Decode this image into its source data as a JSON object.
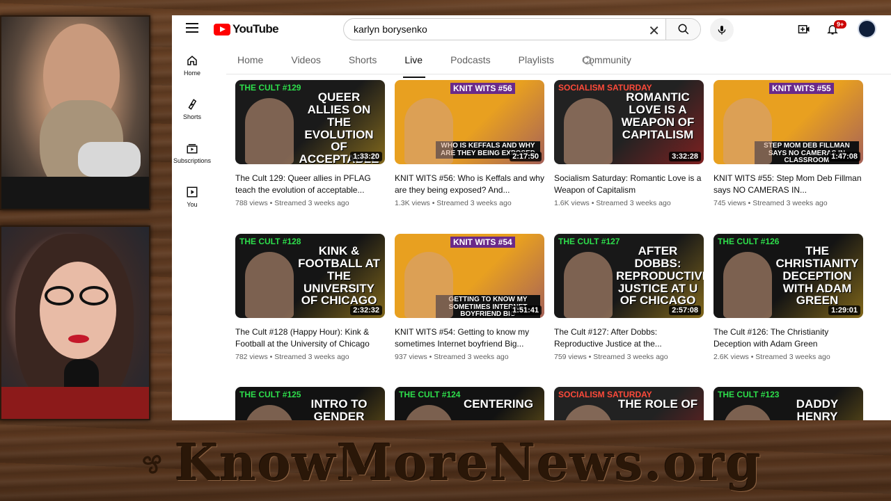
{
  "overlay": {
    "watermark": "KnowMoreNews.org"
  },
  "header": {
    "logo_text": "YouTube",
    "search_value": "karlyn borysenko",
    "notifications_badge": "9+"
  },
  "sidebar": {
    "items": [
      {
        "label": "Home",
        "icon": "home-icon"
      },
      {
        "label": "Shorts",
        "icon": "shorts-icon"
      },
      {
        "label": "Subscriptions",
        "icon": "subscriptions-icon"
      },
      {
        "label": "You",
        "icon": "you-icon"
      }
    ]
  },
  "tabs": [
    {
      "label": "Home"
    },
    {
      "label": "Videos"
    },
    {
      "label": "Shorts"
    },
    {
      "label": "Live",
      "active": true
    },
    {
      "label": "Podcasts"
    },
    {
      "label": "Playlists"
    },
    {
      "label": "Community"
    }
  ],
  "videos": [
    {
      "title": "The Cult 129: Queer allies in PFLAG teach the evolution of acceptable...",
      "meta": "788 views • Streamed 3 weeks ago",
      "duration": "1:33:20",
      "thumb_text": "Queer Allies on the Evolution of Acceptable Language",
      "tag": "THE CULT #129",
      "bg": "#1a1a1a",
      "accent": "#e0b020"
    },
    {
      "title": "KNIT WITS #56: Who is Keffals and why are they being exposed? And...",
      "meta": "1.3K views • Streamed 3 weeks ago",
      "duration": "2:17:50",
      "thumb_text": "Who is Keffals and Why are They Being Exposed",
      "tag": "KNIT WITS #56",
      "bg": "#e8a020",
      "accent": "#6a2a8a"
    },
    {
      "title": "Socialism Saturday: Romantic Love is a Weapon of Capitalism",
      "meta": "1.6K views • Streamed 3 weeks ago",
      "duration": "3:32:28",
      "thumb_text": "Romantic Love is a Weapon of Capitalism",
      "tag": "SOCIALISM SATURDAY",
      "bg": "#222222",
      "accent": "#d02020"
    },
    {
      "title": "KNIT WITS #55: Step Mom Deb Fillman says NO CAMERAS IN...",
      "meta": "745 views • Streamed 3 weeks ago",
      "duration": "1:47:08",
      "thumb_text": "Step Mom Deb Fillman Says No Cameras in Classroom",
      "tag": "KNIT WITS #55",
      "bg": "#e8a020",
      "accent": "#6a2a8a"
    },
    {
      "title": "The Cult #128 (Happy Hour): Kink & Football at the University of Chicago",
      "meta": "782 views • Streamed 3 weeks ago",
      "duration": "2:32:32",
      "thumb_text": "Kink & Football at the University of Chicago",
      "tag": "THE CULT #128",
      "bg": "#151515",
      "accent": "#e0b020"
    },
    {
      "title": "KNIT WITS #54: Getting to know my sometimes Internet boyfriend Big...",
      "meta": "937 views • Streamed 3 weeks ago",
      "duration": "1:51:41",
      "thumb_text": "Getting to Know My Sometimes Internet Boyfriend Big",
      "tag": "KNIT WITS #54",
      "bg": "#e8a020",
      "accent": "#6a2a8a"
    },
    {
      "title": "The Cult #127: After Dobbs: Reproductive Justice at the...",
      "meta": "759 views • Streamed 3 weeks ago",
      "duration": "2:57:08",
      "thumb_text": "After Dobbs: Reproductive Justice at U of Chicago",
      "tag": "THE CULT #127",
      "bg": "#181818",
      "accent": "#e0b020"
    },
    {
      "title": "The Cult #126: The Christianity Deception with Adam Green",
      "meta": "2.6K views • Streamed 3 weeks ago",
      "duration": "1:29:01",
      "thumb_text": "The Christianity Deception with Adam Green",
      "tag": "THE CULT #126",
      "bg": "#141414",
      "accent": "#e0b020"
    },
    {
      "title": "",
      "meta": "",
      "duration": "",
      "thumb_text": "Intro to Gender Equity at the",
      "tag": "THE CULT #125",
      "bg": "#121212",
      "accent": "#e0b020"
    },
    {
      "title": "",
      "meta": "",
      "duration": "",
      "thumb_text": "Centering",
      "tag": "THE CULT #124",
      "bg": "#121212",
      "accent": "#e0b020"
    },
    {
      "title": "",
      "meta": "",
      "duration": "",
      "thumb_text": "The Role of",
      "tag": "SOCIALISM SATURDAY",
      "bg": "#222222",
      "accent": "#d02020"
    },
    {
      "title": "",
      "meta": "",
      "duration": "",
      "thumb_text": "Daddy Henry Giroux on",
      "tag": "THE CULT #123",
      "bg": "#141414",
      "accent": "#e0b020"
    }
  ]
}
